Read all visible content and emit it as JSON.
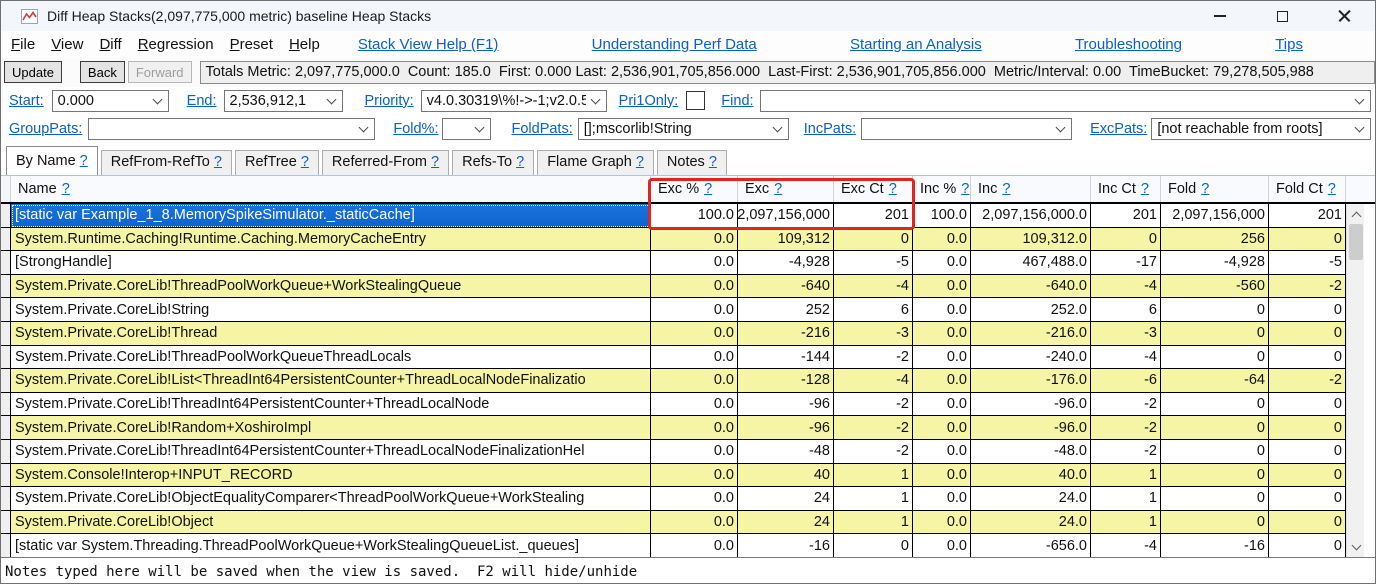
{
  "window": {
    "title": "Diff Heap Stacks(2,097,775,000 metric) baseline Heap Stacks"
  },
  "menu_bar": {
    "items": [
      "File",
      "View",
      "Diff",
      "Regression",
      "Preset",
      "Help"
    ],
    "links": [
      "Stack View Help (F1)",
      "Understanding Perf Data",
      "Starting an Analysis",
      "Troubleshooting",
      "Tips"
    ]
  },
  "toolbar": {
    "update_label": "Update",
    "back_label": "Back",
    "forward_label": "Forward",
    "totals": "Totals Metric: 2,097,775,000.0  Count: 185.0  First: 0.000 Last: 2,536,901,705,856.000  Last-First: 2,536,901,705,856.000  Metric/Interval: 0.00  TimeBucket: 79,278,505,988"
  },
  "filters": {
    "start": {
      "label": "Start:",
      "value": "0.000"
    },
    "end": {
      "label": "End:",
      "value": "2,536,912,1"
    },
    "priority": {
      "label": "Priority:",
      "value": "v4.0.30319\\%!->-1;v2.0.5"
    },
    "pri1only": {
      "label": "Pri1Only:",
      "checked": false
    },
    "find": {
      "label": "Find:",
      "value": ""
    },
    "grouppats": {
      "label": "GroupPats:",
      "value": ""
    },
    "foldpct": {
      "label": "Fold%:",
      "value": ""
    },
    "foldpats": {
      "label": "FoldPats:",
      "value": "[];mscorlib!String"
    },
    "incpats": {
      "label": "IncPats:",
      "value": ""
    },
    "excpats": {
      "label": "ExcPats:",
      "value": "[not reachable from roots]"
    }
  },
  "tabs": {
    "help_glyph": "?",
    "active_index": 0,
    "items": [
      "By Name",
      "RefFrom-RefTo",
      "RefTree",
      "Referred-From",
      "Refs-To",
      "Flame Graph",
      "Notes"
    ]
  },
  "table": {
    "help_glyph": "?",
    "columns": [
      "Name",
      "Exc %",
      "Exc",
      "Exc Ct",
      "Inc %",
      "Inc",
      "Inc Ct",
      "Fold",
      "Fold Ct"
    ],
    "rows": [
      {
        "name": "[static var Example_1_8.MemorySpikeSimulator._staticCache]",
        "selected": true,
        "values": [
          "100.0",
          "2,097,156,000",
          "201",
          "100.0",
          "2,097,156,000.0",
          "201",
          "2,097,156,000",
          "201"
        ]
      },
      {
        "name": "System.Runtime.Caching!Runtime.Caching.MemoryCacheEntry",
        "values": [
          "0.0",
          "109,312",
          "0",
          "0.0",
          "109,312.0",
          "0",
          "256",
          "0"
        ]
      },
      {
        "name": "[StrongHandle]",
        "values": [
          "0.0",
          "-4,928",
          "-5",
          "0.0",
          "467,488.0",
          "-17",
          "-4,928",
          "-5"
        ]
      },
      {
        "name": "System.Private.CoreLib!ThreadPoolWorkQueue+WorkStealingQueue",
        "values": [
          "0.0",
          "-640",
          "-4",
          "0.0",
          "-640.0",
          "-4",
          "-560",
          "-2"
        ]
      },
      {
        "name": "System.Private.CoreLib!String",
        "values": [
          "0.0",
          "252",
          "6",
          "0.0",
          "252.0",
          "6",
          "0",
          "0"
        ]
      },
      {
        "name": "System.Private.CoreLib!Thread",
        "values": [
          "0.0",
          "-216",
          "-3",
          "0.0",
          "-216.0",
          "-3",
          "0",
          "0"
        ]
      },
      {
        "name": "System.Private.CoreLib!ThreadPoolWorkQueueThreadLocals",
        "values": [
          "0.0",
          "-144",
          "-2",
          "0.0",
          "-240.0",
          "-4",
          "0",
          "0"
        ]
      },
      {
        "name": "System.Private.CoreLib!List<ThreadInt64PersistentCounter+ThreadLocalNodeFinalizatio",
        "values": [
          "0.0",
          "-128",
          "-4",
          "0.0",
          "-176.0",
          "-6",
          "-64",
          "-2"
        ]
      },
      {
        "name": "System.Private.CoreLib!ThreadInt64PersistentCounter+ThreadLocalNode",
        "values": [
          "0.0",
          "-96",
          "-2",
          "0.0",
          "-96.0",
          "-2",
          "0",
          "0"
        ]
      },
      {
        "name": "System.Private.CoreLib!Random+XoshiroImpl",
        "values": [
          "0.0",
          "-96",
          "-2",
          "0.0",
          "-96.0",
          "-2",
          "0",
          "0"
        ]
      },
      {
        "name": "System.Private.CoreLib!ThreadInt64PersistentCounter+ThreadLocalNodeFinalizationHel",
        "values": [
          "0.0",
          "-48",
          "-2",
          "0.0",
          "-48.0",
          "-2",
          "0",
          "0"
        ]
      },
      {
        "name": "System.Console!Interop+INPUT_RECORD",
        "values": [
          "0.0",
          "40",
          "1",
          "0.0",
          "40.0",
          "1",
          "0",
          "0"
        ]
      },
      {
        "name": "System.Private.CoreLib!ObjectEqualityComparer<ThreadPoolWorkQueue+WorkStealing",
        "values": [
          "0.0",
          "24",
          "1",
          "0.0",
          "24.0",
          "1",
          "0",
          "0"
        ]
      },
      {
        "name": "System.Private.CoreLib!Object",
        "values": [
          "0.0",
          "24",
          "1",
          "0.0",
          "24.0",
          "1",
          "0",
          "0"
        ]
      },
      {
        "name": "[static var System.Threading.ThreadPoolWorkQueue+WorkStealingQueueList._queues]",
        "values": [
          "0.0",
          "-16",
          "0",
          "0.0",
          "-656.0",
          "-4",
          "-16",
          "0"
        ]
      }
    ]
  },
  "notes": {
    "text": "Notes typed here will be saved when the view is saved.  F2 will hide/unhide"
  },
  "colors": {
    "selection_blue": "#0d63cd",
    "selection_blue_light": "#1a74de",
    "row_yellow": "#f5f5a5",
    "link_blue": "#0b61c4",
    "annotation_red": "#e0261c"
  }
}
